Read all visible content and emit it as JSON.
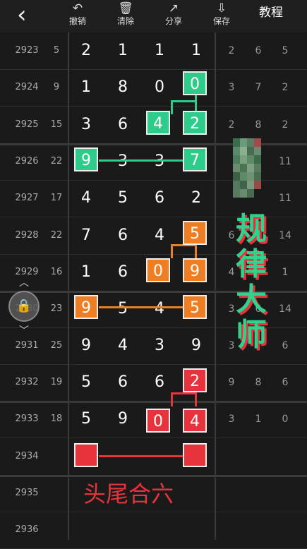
{
  "toolbar": {
    "undo_label": "撤销",
    "clear_label": "清除",
    "share_label": "分享",
    "save_label": "保存",
    "tutorial_label": "教程",
    "undo_icon": "↶",
    "clear_icon": "🗑",
    "share_icon": "↗",
    "save_icon": "⇩",
    "back_icon": "‹"
  },
  "rows": [
    {
      "period": "2923",
      "sum": "5",
      "d": [
        "2",
        "1",
        "1",
        "1"
      ],
      "r": [
        "2",
        "6",
        "5"
      ]
    },
    {
      "period": "2924",
      "sum": "9",
      "d": [
        "1",
        "8",
        "0",
        "0"
      ],
      "r": [
        "3",
        "7",
        "2"
      ]
    },
    {
      "period": "2925",
      "sum": "15",
      "d": [
        "3",
        "6",
        "4",
        "2"
      ],
      "r": [
        "2",
        "8",
        "2"
      ]
    },
    {
      "period": "2926",
      "sum": "22",
      "d": [
        "9",
        "3",
        "3",
        "7"
      ],
      "r": [
        "",
        "",
        "11"
      ]
    },
    {
      "period": "2927",
      "sum": "17",
      "d": [
        "4",
        "5",
        "6",
        "2"
      ],
      "r": [
        "",
        "",
        "11"
      ]
    },
    {
      "period": "2928",
      "sum": "22",
      "d": [
        "7",
        "6",
        "4",
        "5"
      ],
      "r": [
        "6",
        "",
        "14"
      ]
    },
    {
      "period": "2929",
      "sum": "16",
      "d": [
        "1",
        "6",
        "0",
        "9"
      ],
      "r": [
        "4",
        "",
        "1"
      ]
    },
    {
      "period": "2930",
      "sum": "23",
      "d": [
        "9",
        "5",
        "4",
        "5"
      ],
      "r": [
        "3",
        "6",
        "14"
      ]
    },
    {
      "period": "2931",
      "sum": "25",
      "d": [
        "9",
        "4",
        "3",
        "9"
      ],
      "r": [
        "3",
        "",
        "6"
      ]
    },
    {
      "period": "2932",
      "sum": "19",
      "d": [
        "5",
        "6",
        "6",
        "2"
      ],
      "r": [
        "9",
        "8",
        "6"
      ]
    },
    {
      "period": "2933",
      "sum": "18",
      "d": [
        "5",
        "9",
        "0",
        "4"
      ],
      "r": [
        "3",
        "1",
        "0"
      ]
    },
    {
      "period": "2934",
      "sum": "",
      "d": [
        "",
        "",
        "",
        ""
      ],
      "r": [
        "",
        "",
        ""
      ]
    },
    {
      "period": "2935",
      "sum": "",
      "d": [
        "",
        "",
        "",
        ""
      ],
      "r": [
        "",
        "",
        ""
      ]
    },
    {
      "period": "2936",
      "sum": "",
      "d": [
        "",
        "",
        "",
        ""
      ],
      "r": [
        "",
        "",
        ""
      ]
    }
  ],
  "overlay": {
    "title_chars": [
      "规",
      "律",
      "大",
      "师"
    ],
    "footer_text": "头尾合六",
    "lock_icon": "🔒"
  },
  "colors": {
    "green": "#2ecc8a",
    "orange": "#ef7d22",
    "red": "#e8333c"
  }
}
